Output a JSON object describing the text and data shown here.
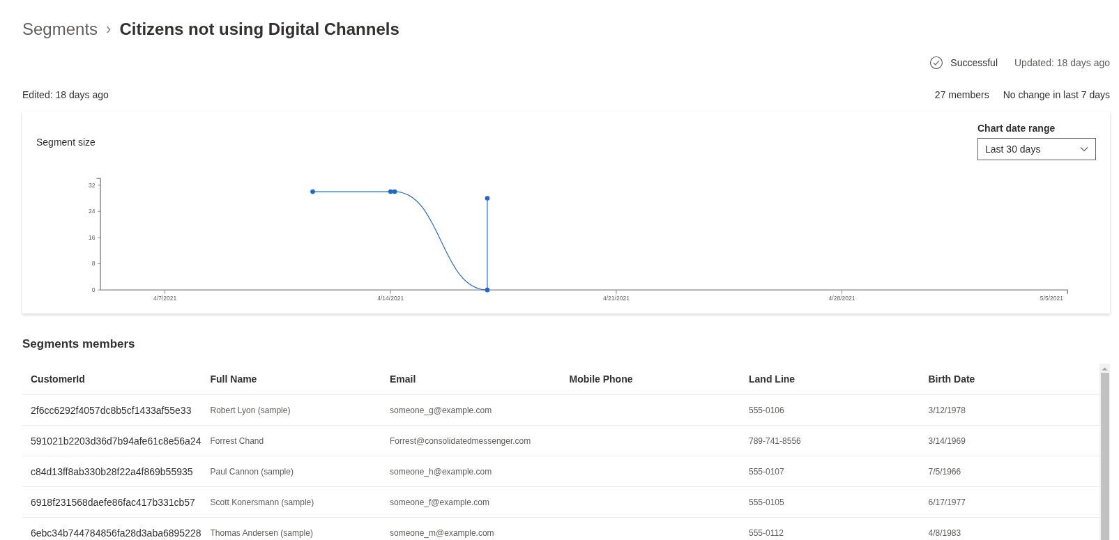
{
  "breadcrumb": {
    "parent": "Segments",
    "separator": "›",
    "title": "Citizens not using Digital Channels"
  },
  "status": {
    "label": "Successful",
    "updated": "Updated: 18 days ago"
  },
  "edited": "Edited: 18 days ago",
  "members_count": "27 members",
  "change_note": "No change in last 7 days",
  "chart_card": {
    "date_range": {
      "label": "Chart date range",
      "value": "Last 30 days"
    },
    "chart_data": {
      "type": "line",
      "title": "Segment size",
      "x": [
        "2021-04-11T14:00:00Z",
        "2021-04-14T00:00:00Z",
        "2021-04-14T03:00:00Z",
        "2021-04-17T00:00:00Z",
        "2021-04-17T00:00:00Z"
      ],
      "series": [
        {
          "color": "#2266cc",
          "marker": "circle",
          "values": [
            30,
            30,
            30,
            0,
            28
          ]
        }
      ],
      "xlim": [
        "2021-04-05T00:00:00Z",
        "2021-05-05T00:00:00Z"
      ],
      "ylim": [
        0,
        34
      ],
      "xticks": [
        {
          "value": "2021-04-07T00:00:00Z",
          "label": "4/7/2021"
        },
        {
          "value": "2021-04-14T00:00:00Z",
          "label": "4/14/2021"
        },
        {
          "value": "2021-04-21T00:00:00Z",
          "label": "4/21/2021"
        },
        {
          "value": "2021-04-28T00:00:00Z",
          "label": "4/28/2021"
        },
        {
          "value": "2021-05-05T00:00:00Z",
          "label": "5/5/2021"
        }
      ],
      "yticks": [
        0,
        8,
        16,
        24,
        32
      ]
    }
  },
  "members": {
    "title": "Segments members",
    "columns": [
      "CustomerId",
      "Full Name",
      "Email",
      "Mobile Phone",
      "Land Line",
      "Birth Date"
    ],
    "rows": [
      {
        "cells": [
          "2f6cc6292f4057dc8b5cf1433af55e33",
          "Robert Lyon (sample)",
          "someone_g@example.com",
          null,
          "555-0106",
          "3/12/1978"
        ]
      },
      {
        "cells": [
          "591021b2203d36d7b94afe61c8e56a24",
          "Forrest Chand",
          "Forrest@consolidatedmessenger.com",
          null,
          "789-741-8556",
          "3/14/1969"
        ]
      },
      {
        "cells": [
          "c84d13ff8ab330b28f22a4f869b55935",
          "Paul Cannon (sample)",
          "someone_h@example.com",
          null,
          "555-0107",
          "7/5/1966"
        ]
      },
      {
        "cells": [
          "6918f231568daefe86fac417b331cb57",
          "Scott Konersmann (sample)",
          "someone_f@example.com",
          null,
          "555-0105",
          "6/17/1977"
        ]
      },
      {
        "cells": [
          "6ebc34b744784856fa28d3aba6895228",
          "Thomas Andersen (sample)",
          "someone_m@example.com",
          null,
          "555-0112",
          "4/8/1983"
        ]
      }
    ]
  }
}
